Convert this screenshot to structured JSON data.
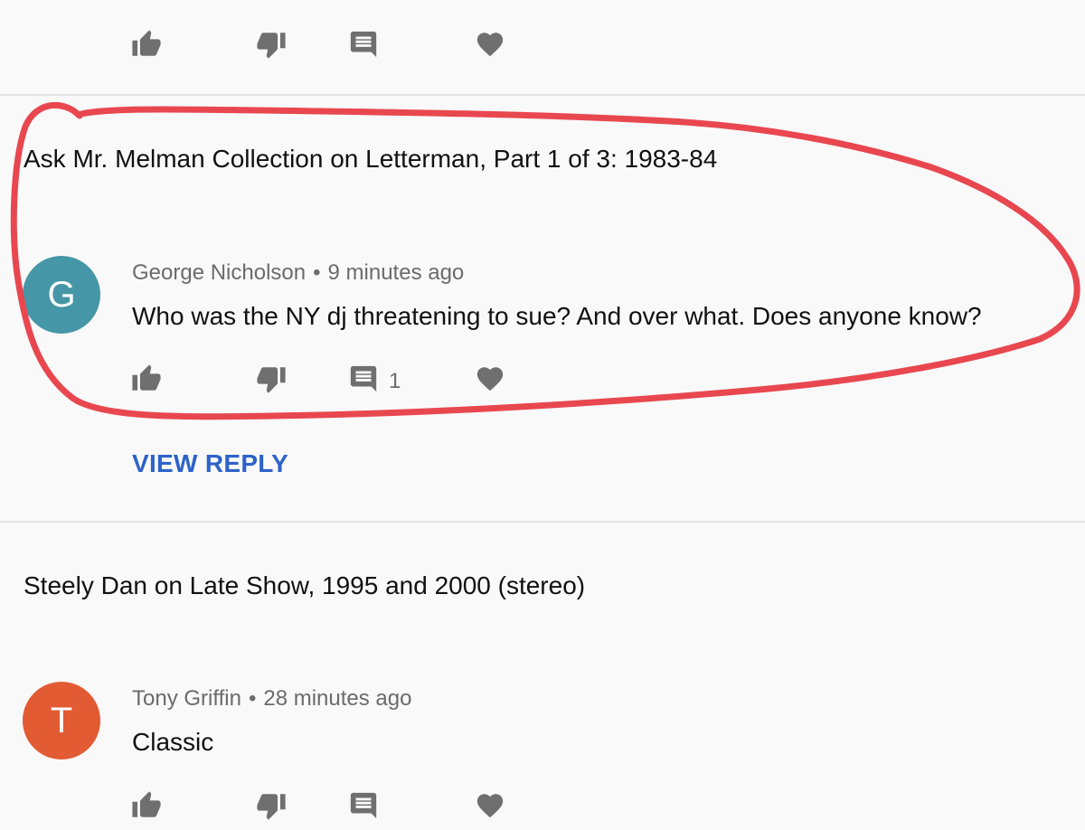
{
  "colors": {
    "background": "#f9f9f9",
    "icon_gray": "#6f6f6f",
    "link_blue": "#2e62c9",
    "annotation_red": "#e8474f",
    "avatar_g": "#4596a6",
    "avatar_t": "#e35b33"
  },
  "icons": {
    "like": "thumbs-up-icon",
    "dislike": "thumbs-down-icon",
    "reply": "comment-icon",
    "heart": "heart-icon"
  },
  "threads": [
    {
      "video_title": "Ask Mr. Melman Collection on Letterman, Part 1 of 3: 1983-84",
      "avatar_letter": "G",
      "author": "George Nicholson",
      "separator": "•",
      "time": "9 minutes ago",
      "text": "Who was the NY dj threatening to sue? And over what. Does anyone know?",
      "reply_count": "1",
      "view_reply": "VIEW REPLY"
    },
    {
      "video_title": "Steely Dan on Late Show, 1995 and 2000 (stereo)",
      "avatar_letter": "T",
      "author": "Tony Griffin",
      "separator": "•",
      "time": "28 minutes ago",
      "text": "Classic"
    }
  ]
}
